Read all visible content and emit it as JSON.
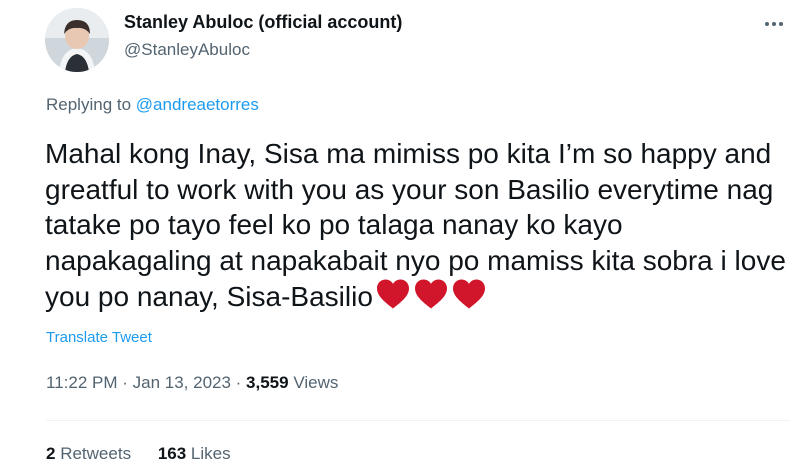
{
  "author": {
    "name": "Stanley Abuloc (official account)",
    "handle": "@StanleyAbuloc"
  },
  "reply": {
    "prefix": "Replying to ",
    "mention": "@andreaetorres"
  },
  "tweet": {
    "text": "Mahal kong Inay, Sisa ma mimiss po kita I’m so happy and greatful to work with you as your son Basilio everytime nag tatake po tayo feel ko po talaga nanay ko kayo napakagaling at napakabait nyo po mamiss kita sobra i love you po nanay, Sisa-Basilio",
    "emoji_count": 3,
    "emoji_color": "#d1162b"
  },
  "translate_label": "Translate Tweet",
  "meta": {
    "time": "11:22 PM",
    "date": "Jan 13, 2023",
    "separator": " · ",
    "views_count": "3,559",
    "views_label": "Views"
  },
  "stats": {
    "retweets_count": "2",
    "retweets_label": "Retweets",
    "likes_count": "163",
    "likes_label": "Likes"
  },
  "icons": [
    "avatar-photo",
    "more-options-icon",
    "red-heart-emoji"
  ]
}
